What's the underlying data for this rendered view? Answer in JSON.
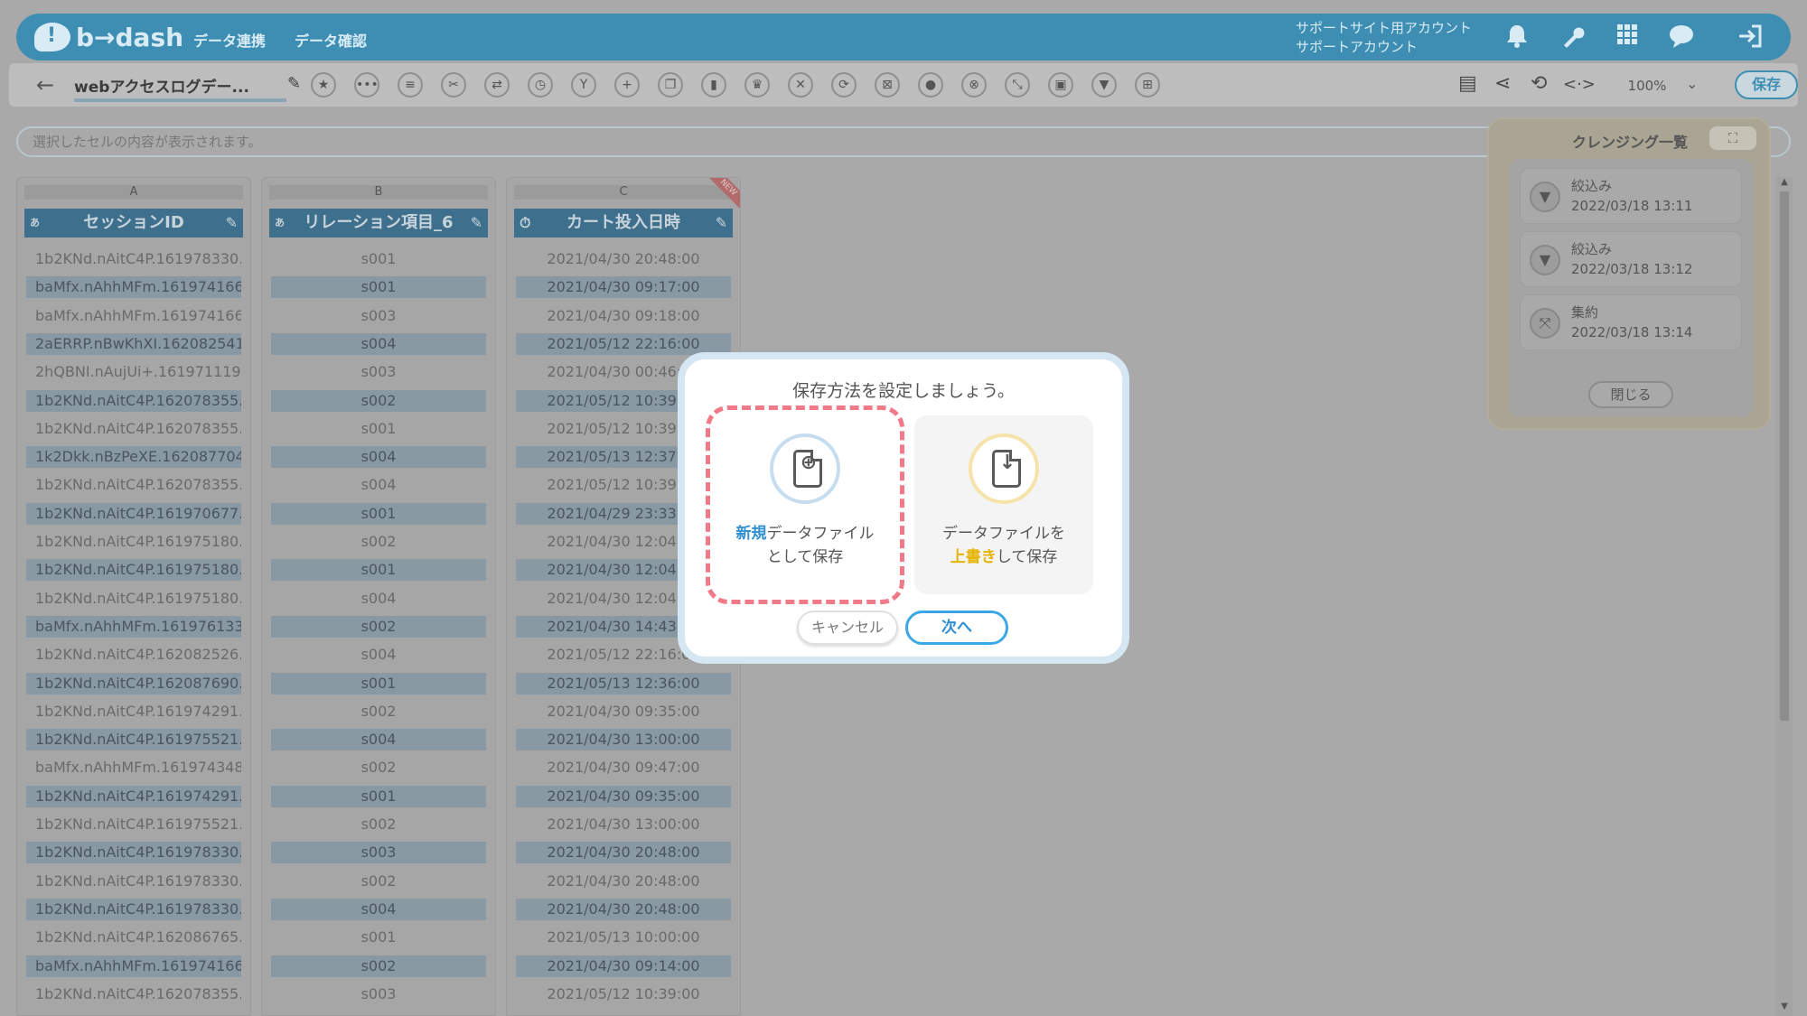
{
  "header": {
    "logo_text": "b→dash",
    "nav": [
      "データ連携",
      "データ確認"
    ],
    "account_line1": "サポートサイト用アカウント",
    "account_line2": "サポートアカウント",
    "icons": [
      "bell-icon",
      "wrench-icon",
      "grid-icon",
      "chat-icon",
      "logout-icon"
    ]
  },
  "toolbar": {
    "back_icon": "←",
    "file_name": "webアクセスログデー...",
    "zoom": "100%",
    "save_label": "保存",
    "tool_icons": [
      "star",
      "dots",
      "list",
      "scissors",
      "merge",
      "timer",
      "branch",
      "plus",
      "copy",
      "trash",
      "crown",
      "collapse",
      "swap",
      "lock",
      "bag",
      "cancel",
      "transform",
      "calc",
      "filter",
      "table"
    ]
  },
  "formula_bar": {
    "placeholder": "選択したセルの内容が表示されます。"
  },
  "grid": {
    "columns": [
      {
        "letter": "A",
        "type": "あ",
        "name": "セッションID"
      },
      {
        "letter": "B",
        "type": "あ",
        "name": "リレーション項目_6"
      },
      {
        "letter": "C",
        "type": "⏱",
        "name": "カート投入日時",
        "badge": "NEW"
      }
    ],
    "rows": [
      [
        "1b2KNd.nAitC4P.161978330...",
        "s001",
        "2021/04/30 20:48:00"
      ],
      [
        "baMfx.nAhhMFm.161974166...",
        "s001",
        "2021/04/30 09:17:00"
      ],
      [
        "baMfx.nAhhMFm.161974166...",
        "s003",
        "2021/04/30 09:18:00"
      ],
      [
        "2aERRP.nBwKhXI.162082541...",
        "s004",
        "2021/05/12 22:16:00"
      ],
      [
        "2hQBNI.nAujUi+.161971119...",
        "s003",
        "2021/04/30 00:46:00"
      ],
      [
        "1b2KNd.nAitC4P.162078355...",
        "s002",
        "2021/05/12 10:39:00"
      ],
      [
        "1b2KNd.nAitC4P.162078355...",
        "s001",
        "2021/05/12 10:39:00"
      ],
      [
        "1k2Dkk.nBzPeXE.162087704...",
        "s004",
        "2021/05/13 12:37:00"
      ],
      [
        "1b2KNd.nAitC4P.162078355...",
        "s004",
        "2021/05/12 10:39:00"
      ],
      [
        "1b2KNd.nAitC4P.161970677...",
        "s001",
        "2021/04/29 23:33:00"
      ],
      [
        "1b2KNd.nAitC4P.161975180...",
        "s002",
        "2021/04/30 12:04:00"
      ],
      [
        "1b2KNd.nAitC4P.161975180...",
        "s001",
        "2021/04/30 12:04:00"
      ],
      [
        "1b2KNd.nAitC4P.161975180...",
        "s004",
        "2021/04/30 12:04:00"
      ],
      [
        "baMfx.nAhhMFm.161976133...",
        "s002",
        "2021/04/30 14:43:00"
      ],
      [
        "1b2KNd.nAitC4P.162082526...",
        "s004",
        "2021/05/12 22:16:00"
      ],
      [
        "1b2KNd.nAitC4P.162087690...",
        "s001",
        "2021/05/13 12:36:00"
      ],
      [
        "1b2KNd.nAitC4P.161974291...",
        "s002",
        "2021/04/30 09:35:00"
      ],
      [
        "1b2KNd.nAitC4P.161975521...",
        "s004",
        "2021/04/30 13:00:00"
      ],
      [
        "baMfx.nAhhMFm.161974348...",
        "s002",
        "2021/04/30 09:47:00"
      ],
      [
        "1b2KNd.nAitC4P.161974291...",
        "s001",
        "2021/04/30 09:35:00"
      ],
      [
        "1b2KNd.nAitC4P.161975521...",
        "s002",
        "2021/04/30 13:00:00"
      ],
      [
        "1b2KNd.nAitC4P.161978330...",
        "s003",
        "2021/04/30 20:48:00"
      ],
      [
        "1b2KNd.nAitC4P.161978330...",
        "s002",
        "2021/04/30 20:48:00"
      ],
      [
        "1b2KNd.nAitC4P.161978330...",
        "s004",
        "2021/04/30 20:48:00"
      ],
      [
        "1b2KNd.nAitC4P.162086765...",
        "s001",
        "2021/05/13 10:00:00"
      ],
      [
        "baMfx.nAhhMFm.161974166...",
        "s002",
        "2021/04/30 09:14:00"
      ],
      [
        "1b2KNd.nAitC4P.162078355...",
        "s003",
        "2021/05/12 10:39:00"
      ]
    ]
  },
  "cleansing_panel": {
    "title": "クレンジング一覧",
    "items": [
      {
        "icon": "filter-icon",
        "label": "絞込み",
        "timestamp": "2022/03/18 13:11"
      },
      {
        "icon": "filter-icon",
        "label": "絞込み",
        "timestamp": "2022/03/18 13:12"
      },
      {
        "icon": "aggregate-icon",
        "label": "集約",
        "timestamp": "2022/03/18 13:14"
      }
    ],
    "close_label": "閉じる"
  },
  "modal": {
    "title": "保存方法を設定しましょう。",
    "option_new": {
      "highlight": "新規",
      "rest": "データファイル",
      "line2": "として保存"
    },
    "option_overwrite": {
      "line1": "データファイルを",
      "highlight": "上書き",
      "rest": "して保存"
    },
    "cancel_label": "キャンセル",
    "next_label": "次へ"
  },
  "colors": {
    "brand": "#3e8eb3",
    "selection_outline": "#f07a87",
    "next_button": "#3aa7e6",
    "highlight_new": "#2f8fd0",
    "highlight_overwrite": "#e6b400"
  }
}
